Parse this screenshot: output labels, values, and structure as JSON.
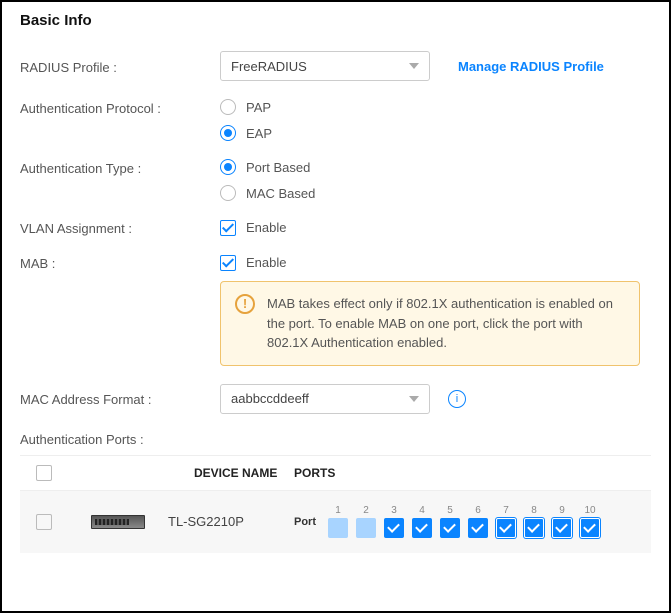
{
  "section_title": "Basic Info",
  "radius": {
    "label": "RADIUS Profile :",
    "selected": "FreeRADIUS",
    "manage_link": "Manage RADIUS Profile"
  },
  "auth_protocol": {
    "label": "Authentication Protocol :",
    "options": [
      "PAP",
      "EAP"
    ],
    "selected": "EAP"
  },
  "auth_type": {
    "label": "Authentication Type :",
    "options": [
      "Port Based",
      "MAC Based"
    ],
    "selected": "Port Based"
  },
  "vlan": {
    "label": "VLAN Assignment :",
    "option": "Enable",
    "checked": true
  },
  "mab": {
    "label": "MAB :",
    "option": "Enable",
    "checked": true
  },
  "alert": "MAB takes effect only if 802.1X authentication is enabled on the port. To enable MAB on one port, click the port with 802.1X Authentication enabled.",
  "mac_format": {
    "label": "MAC Address Format :",
    "selected": "aabbccddeeff"
  },
  "auth_ports_label": "Authentication Ports :",
  "table": {
    "headers": {
      "device": "DEVICE NAME",
      "ports": "PORTS"
    },
    "row": {
      "name": "TL-SG2210P",
      "port_row_label": "Port",
      "ports": [
        {
          "n": "1",
          "state": "disabled"
        },
        {
          "n": "2",
          "state": "disabled"
        },
        {
          "n": "3",
          "state": "enabled"
        },
        {
          "n": "4",
          "state": "enabled"
        },
        {
          "n": "5",
          "state": "enabled"
        },
        {
          "n": "6",
          "state": "enabled"
        },
        {
          "n": "7",
          "state": "enabled",
          "outlined": true
        },
        {
          "n": "8",
          "state": "enabled",
          "outlined": true
        },
        {
          "n": "9",
          "state": "enabled",
          "outlined": true
        },
        {
          "n": "10",
          "state": "enabled",
          "outlined": true
        }
      ]
    }
  }
}
